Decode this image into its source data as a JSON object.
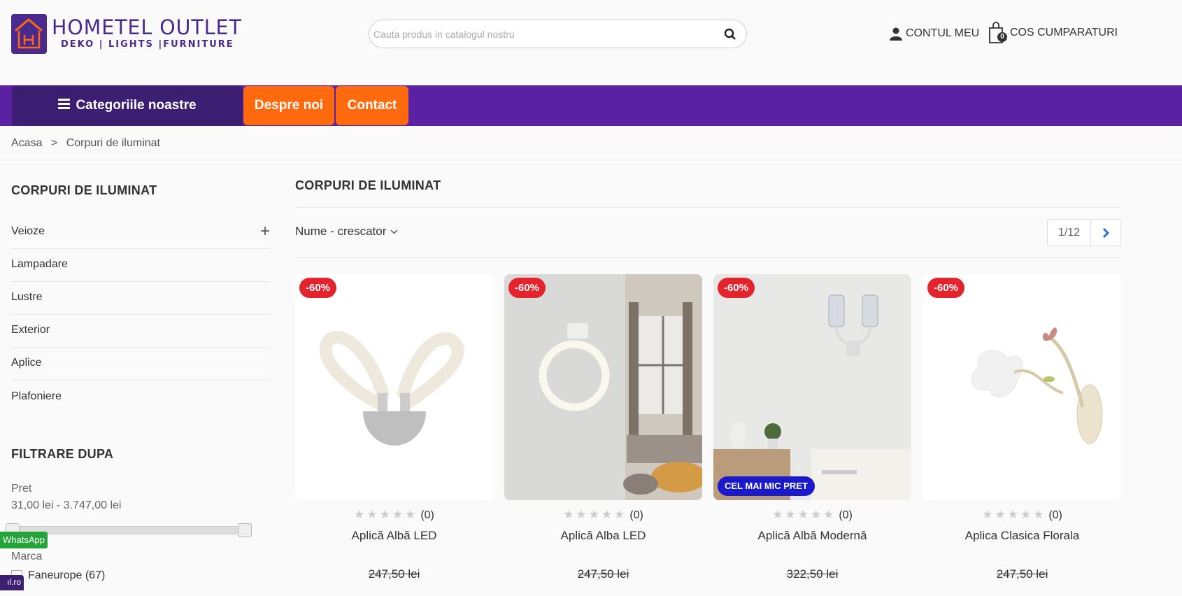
{
  "header": {
    "brand_name": "HOMETEL OUTLET",
    "brand_tagline": "DEKO | LIGHTS |FURNITURE",
    "search_placeholder": "Cauta produs in catalogul nostru",
    "account_label": "CONTUL MEU",
    "cart_label": "COS CUMPARATURI",
    "cart_count": "0"
  },
  "nav": {
    "categories_label": "Categoriile noastre",
    "about_label": "Despre noi",
    "contact_label": "Contact",
    "colors": {
      "bar": "#5a22a2",
      "categories_bg": "#3c1f72",
      "button_bg": "#ff6a0e"
    }
  },
  "breadcrumb": {
    "home": "Acasa",
    "separator": ">",
    "current": "Corpuri de iluminat"
  },
  "sidebar": {
    "title": "CORPURI DE ILUMINAT",
    "items": [
      {
        "label": "Veioze",
        "expand": "+"
      },
      {
        "label": "Lampadare"
      },
      {
        "label": "Lustre"
      },
      {
        "label": "Exterior"
      },
      {
        "label": "Aplice"
      },
      {
        "label": "Plafoniere"
      }
    ],
    "filter_title": "FILTRARE DUPA",
    "price_label": "Pret",
    "price_range": "31,00 lei - 3.747,00 lei",
    "brand_label": "Marca",
    "brand_option": "Faneurope (67)",
    "whatsapp_label": "WhatsApp",
    "bottom_badge": "ıl.ro"
  },
  "main": {
    "title": "CORPURI DE ILUMINAT",
    "sort_label": "Nume - crescator",
    "pagination": "1/12"
  },
  "products": [
    {
      "name": "Aplică Albă LED",
      "discount": "-60%",
      "reviews": "(0)",
      "old_price": "247,50 lei",
      "rating": 0
    },
    {
      "name": "Aplică Alba LED",
      "discount": "-60%",
      "reviews": "(0)",
      "old_price": "247,50 lei",
      "rating": 0
    },
    {
      "name": "Aplică Albă Modernă",
      "discount": "-60%",
      "reviews": "(0)",
      "old_price": "322,50 lei",
      "badge": "CEL MAI MIC PRET",
      "rating": 0
    },
    {
      "name": "Aplica Clasica Florala",
      "discount": "-60%",
      "reviews": "(0)",
      "old_price": "247,50 lei",
      "rating": 0
    }
  ]
}
